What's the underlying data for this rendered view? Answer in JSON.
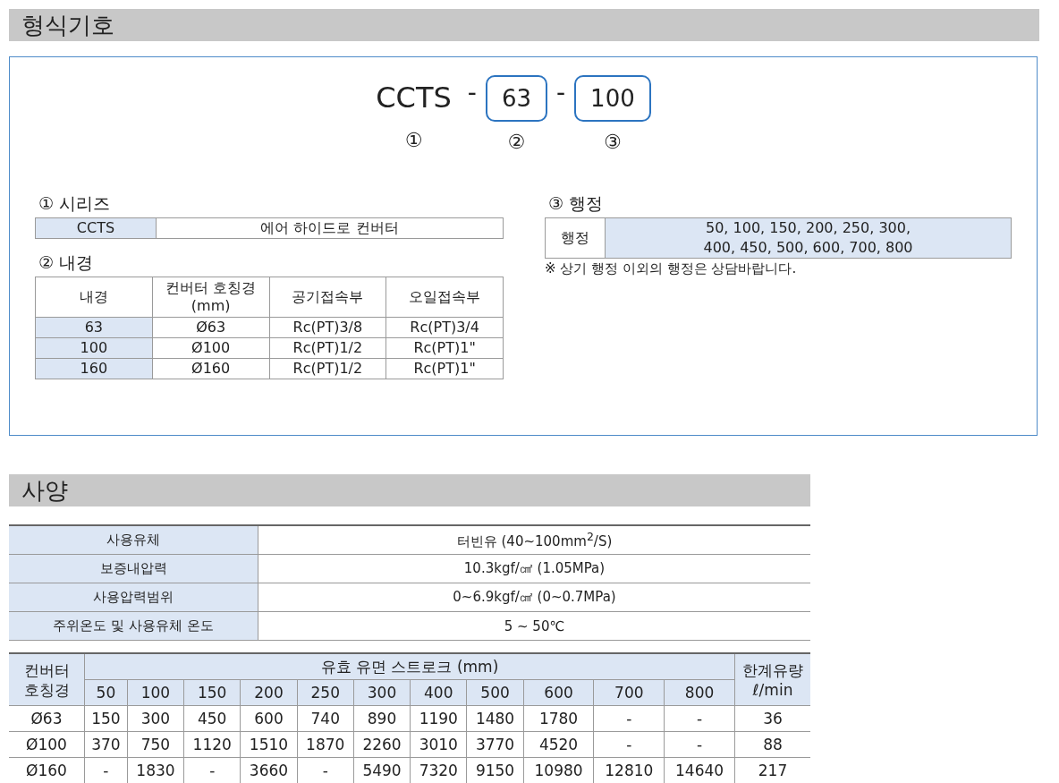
{
  "sections": [
    {
      "title": "형식기호"
    },
    {
      "title": "사양"
    }
  ],
  "model_code": {
    "parts": [
      {
        "kind": "plain",
        "text": "CCTS",
        "marker": "①"
      },
      {
        "kind": "dash",
        "text": "-"
      },
      {
        "kind": "boxed",
        "text": "63",
        "marker": "②"
      },
      {
        "kind": "dash",
        "text": "-"
      },
      {
        "kind": "boxed",
        "text": "100",
        "marker": "③"
      }
    ]
  },
  "series": {
    "title": "① 시리즈",
    "code": "CCTS",
    "name": "에어 하이드로 컨버터"
  },
  "bore": {
    "title": "② 내경",
    "columns": [
      "내경",
      "컨버터 호칭경\n(mm)",
      "공기접속부",
      "오일접속부"
    ],
    "rows": [
      [
        "63",
        "Ø63",
        "Rc(PT)3/8",
        "Rc(PT)3/4"
      ],
      [
        "100",
        "Ø100",
        "Rc(PT)1/2",
        "Rc(PT)1\""
      ],
      [
        "160",
        "Ø160",
        "Rc(PT)1/2",
        "Rc(PT)1\""
      ]
    ]
  },
  "stroke": {
    "title": "③ 행정",
    "label": "행정",
    "value": "50, 100, 150, 200, 250, 300,\n400, 450, 500, 600, 700, 800",
    "note": "※ 상기 행정 이외의 행정은 상담바랍니다."
  },
  "specs": [
    {
      "label": "사용유체",
      "value": "터빈유 (40~100mm$^{2}$/S)"
    },
    {
      "label": "보증내압력",
      "value": "10.3kgf/㎠ (1.05MPa)"
    },
    {
      "label": "사용압력범위",
      "value": "0~6.9kgf/㎠ (0~0.7MPa)"
    },
    {
      "label": "주위온도 및 사용유체 온도",
      "value": "5 ~ 50℃"
    }
  ],
  "stroke_table": {
    "corner": "컨버터\n호칭경",
    "group": "유효 유면 스트로크 (mm)",
    "last": "한계유량\nℓ/min",
    "strokes": [
      "50",
      "100",
      "150",
      "200",
      "250",
      "300",
      "400",
      "500",
      "600",
      "700",
      "800"
    ],
    "rows": [
      {
        "size": "Ø63",
        "values": [
          "150",
          "300",
          "450",
          "600",
          "740",
          "890",
          "1190",
          "1480",
          "1780",
          "-",
          "-"
        ],
        "flow": "36"
      },
      {
        "size": "Ø100",
        "values": [
          "370",
          "750",
          "1120",
          "1510",
          "1870",
          "2260",
          "3010",
          "3770",
          "4520",
          "-",
          "-"
        ],
        "flow": "88"
      },
      {
        "size": "Ø160",
        "values": [
          "-",
          "1830",
          "-",
          "3660",
          "-",
          "5490",
          "7320",
          "9150",
          "10980",
          "12810",
          "14640"
        ],
        "flow": "217"
      }
    ]
  }
}
